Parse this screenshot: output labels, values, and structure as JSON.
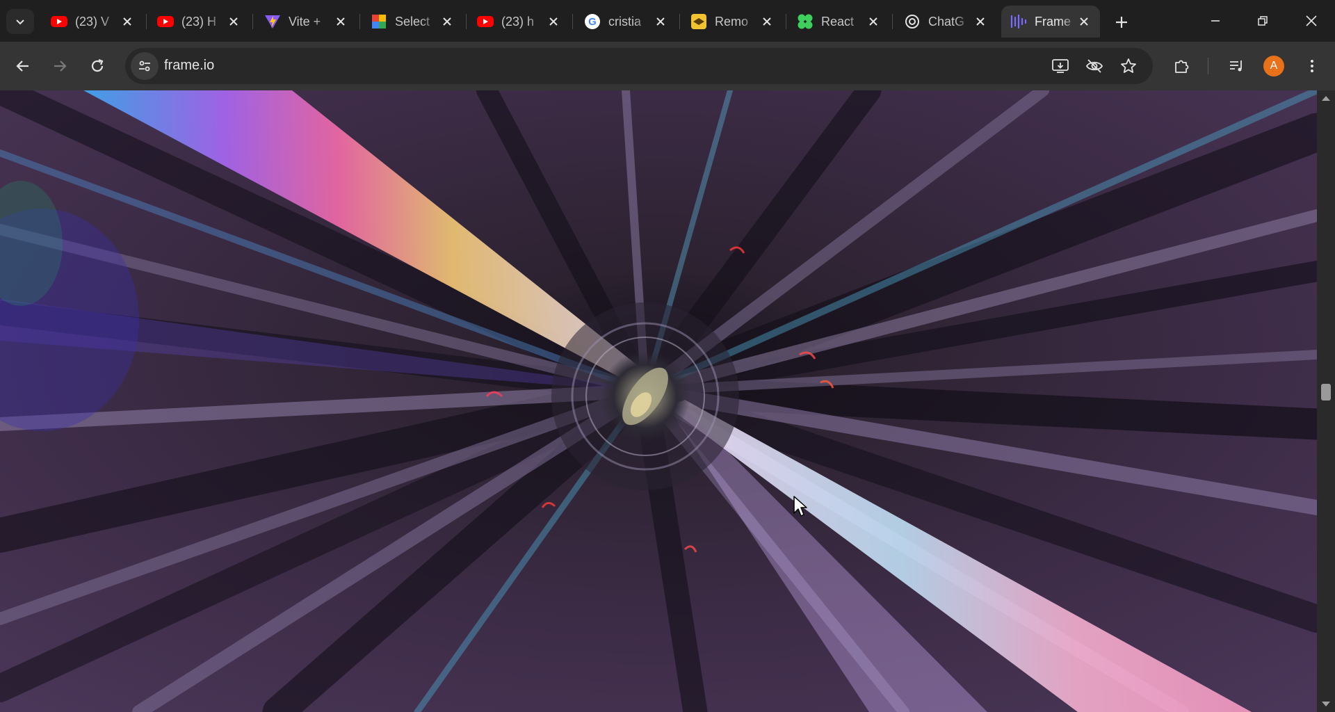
{
  "tabs": [
    {
      "title": "(23) V",
      "favicon": "youtube-icon"
    },
    {
      "title": "(23) H",
      "favicon": "youtube-icon"
    },
    {
      "title": "Vite +",
      "favicon": "vite-icon"
    },
    {
      "title": "Select",
      "favicon": "colorful-icon"
    },
    {
      "title": "(23) h",
      "favicon": "youtube-icon"
    },
    {
      "title": "cristia",
      "favicon": "google-icon"
    },
    {
      "title": "Remo",
      "favicon": "remote-icon"
    },
    {
      "title": "React",
      "favicon": "react-clover-icon"
    },
    {
      "title": "ChatG",
      "favicon": "chatgpt-icon"
    },
    {
      "title": "Frame",
      "favicon": "frameio-icon",
      "active": true
    }
  ],
  "address_bar": {
    "url": "frame.io"
  },
  "profile": {
    "initial": "A",
    "color": "#e8711a"
  },
  "colors": {
    "youtube_red": "#ff0000",
    "frame_purple": "#6b5cff",
    "toolbar": "#353535",
    "tabstrip": "#1f1f1f"
  }
}
